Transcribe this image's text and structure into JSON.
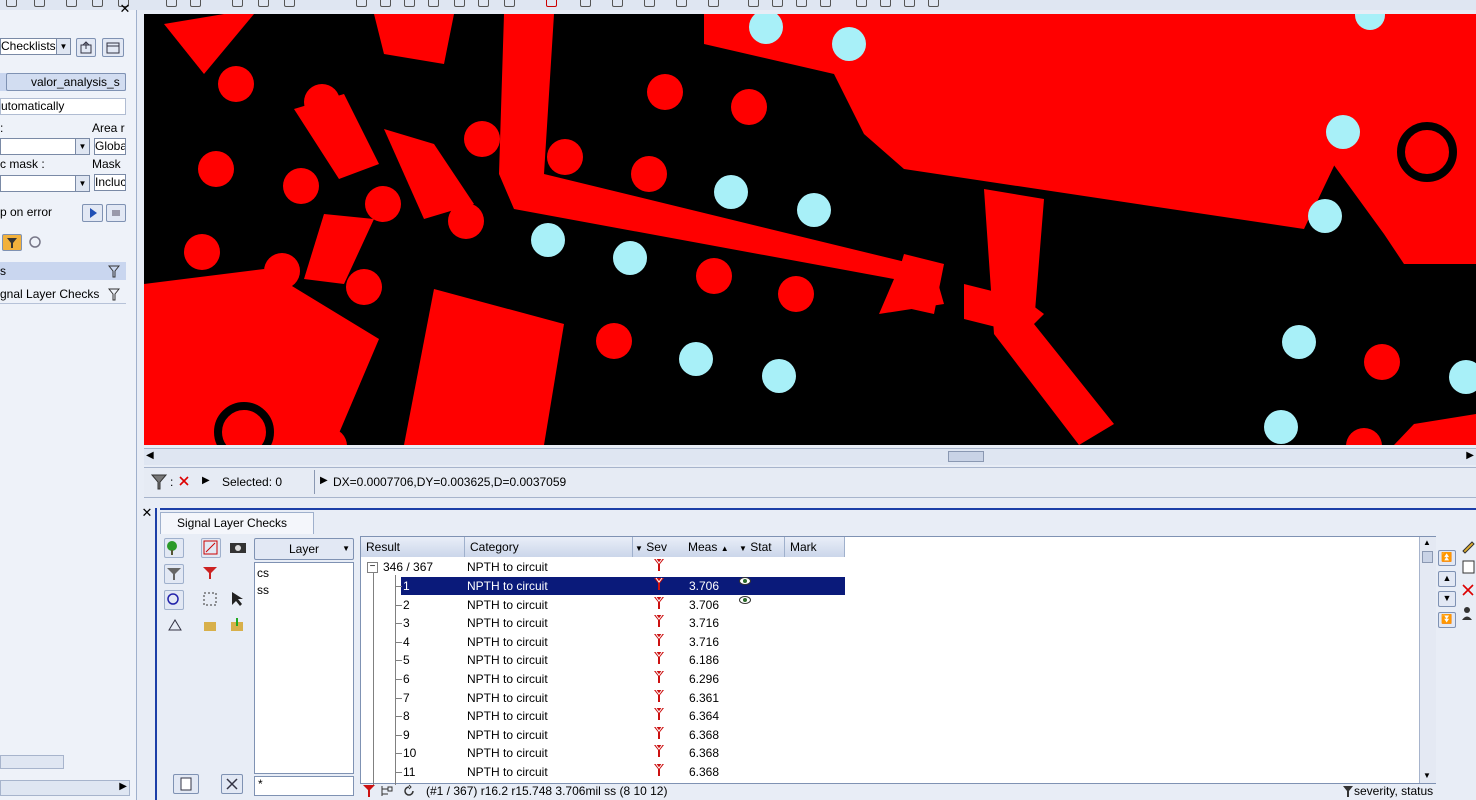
{
  "left_panel": {
    "checklist_select": "Checklists",
    "tab_label": "valor_analysis_s",
    "mode_value": "utomatically",
    "area_label": "Area r",
    "colon_label": ":",
    "area_value": "Globa",
    "mask_left_label": "c mask :",
    "mask_right_label": "Mask",
    "mask_value": "Incluc",
    "stop_on_error": "p on error",
    "tree_item_1": "s",
    "tree_item_2": "gnal Layer Checks"
  },
  "status_bar": {
    "filter_colon": ":",
    "selected": "Selected: 0",
    "measure": "DX=0.0007706,DY=0.003625,D=0.0037059"
  },
  "bottom_panel": {
    "tab": "Signal Layer Checks",
    "layer_dropdown": "Layer",
    "layers": [
      "cs",
      "ss"
    ],
    "layer_filter_value": "*",
    "columns": {
      "result": "Result",
      "category": "Category",
      "sev": "Sev",
      "meas": "Meas",
      "stat": "Stat",
      "mark": "Mark"
    },
    "group_row": {
      "result": "346 / 367",
      "category": "NPTH to circuit"
    },
    "rows": [
      {
        "result": "1",
        "category": "NPTH to circuit",
        "meas": "3.706",
        "stat": "eye"
      },
      {
        "result": "2",
        "category": "NPTH to circuit",
        "meas": "3.706",
        "stat": "eye"
      },
      {
        "result": "3",
        "category": "NPTH to circuit",
        "meas": "3.716",
        "stat": ""
      },
      {
        "result": "4",
        "category": "NPTH to circuit",
        "meas": "3.716",
        "stat": ""
      },
      {
        "result": "5",
        "category": "NPTH to circuit",
        "meas": "6.186",
        "stat": ""
      },
      {
        "result": "6",
        "category": "NPTH to circuit",
        "meas": "6.296",
        "stat": ""
      },
      {
        "result": "7",
        "category": "NPTH to circuit",
        "meas": "6.361",
        "stat": ""
      },
      {
        "result": "8",
        "category": "NPTH to circuit",
        "meas": "6.364",
        "stat": ""
      },
      {
        "result": "9",
        "category": "NPTH to circuit",
        "meas": "6.368",
        "stat": ""
      },
      {
        "result": "10",
        "category": "NPTH to circuit",
        "meas": "6.368",
        "stat": ""
      },
      {
        "result": "11",
        "category": "NPTH to circuit",
        "meas": "6.368",
        "stat": ""
      }
    ],
    "selected_row": 0,
    "footer": {
      "info": "(#1 / 367)  r16.2 r15.748  3.706mil  ss  (8 10 12)",
      "sort": "severity, status"
    }
  },
  "colors": {
    "copper": "#ff0000",
    "drill": "#a8f0f8",
    "background": "#000000",
    "selection": "#0a1a7a",
    "severity_icon": "#cc1111"
  }
}
